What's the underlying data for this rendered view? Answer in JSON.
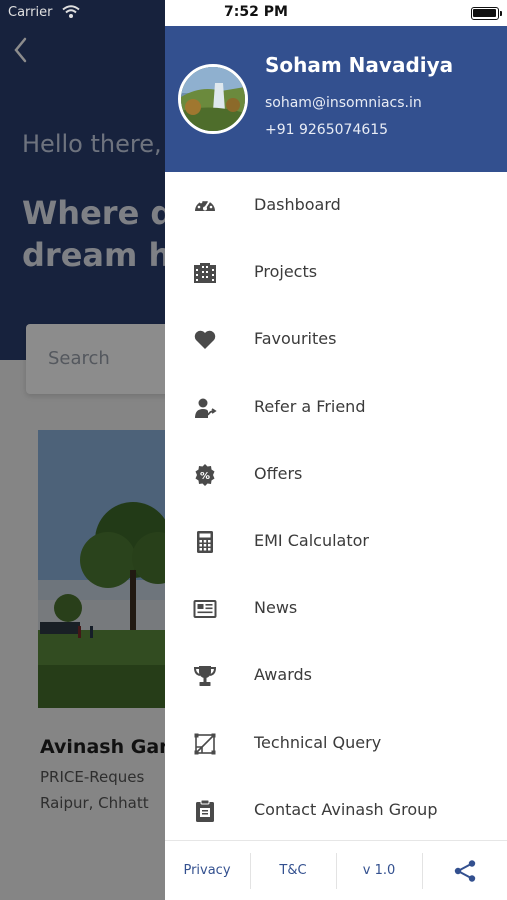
{
  "status_bar": {
    "carrier": "Carrier",
    "time": "7:52 PM"
  },
  "background": {
    "back_icon": "chevron-left-icon",
    "greeting": "Hello there,",
    "headline_line1": "Where d",
    "headline_line2": "dream h",
    "search_placeholder": "Search",
    "card": {
      "title": "Avinash Gar",
      "price": "PRICE-Reques",
      "location": "Raipur, Chhatt"
    }
  },
  "profile": {
    "name": "Soham Navadiya",
    "email": "soham@insomniacs.in",
    "phone": "+91 9265074615"
  },
  "menu": [
    {
      "icon": "dashboard-gauge-icon",
      "label": "Dashboard"
    },
    {
      "icon": "buildings-icon",
      "label": "Projects"
    },
    {
      "icon": "heart-icon",
      "label": "Favourites"
    },
    {
      "icon": "refer-friend-icon",
      "label": "Refer a Friend"
    },
    {
      "icon": "percent-badge-icon",
      "label": "Offers"
    },
    {
      "icon": "calculator-icon",
      "label": "EMI Calculator"
    },
    {
      "icon": "newspaper-icon",
      "label": "News"
    },
    {
      "icon": "trophy-icon",
      "label": "Awards"
    },
    {
      "icon": "technical-query-icon",
      "label": "Technical Query"
    },
    {
      "icon": "contact-icon",
      "label": "Contact Avinash Group"
    }
  ],
  "footer": {
    "privacy": "Privacy",
    "tnc": "T&C",
    "version": "v 1.0",
    "share_icon": "share-icon"
  },
  "colors": {
    "drawer_header": "#33508f",
    "hero": "#2b3f70",
    "menu_text": "#3b3b3b",
    "icon": "#4a4a4a",
    "footer_text": "#33508f"
  }
}
